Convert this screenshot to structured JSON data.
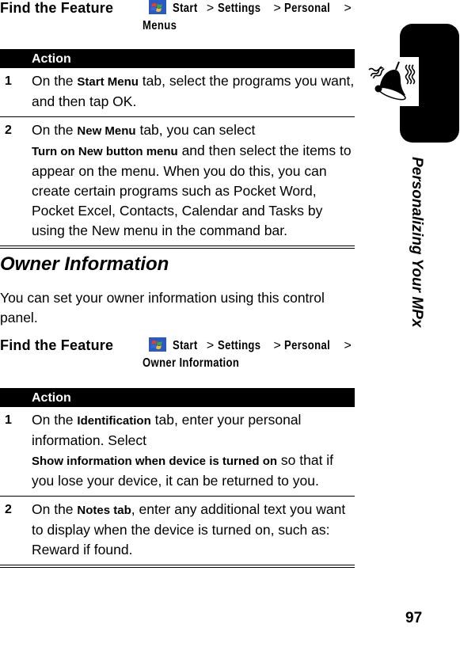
{
  "ftf1": {
    "label": "Find the Feature",
    "path": [
      "Start",
      "Settings",
      "Personal",
      "Menus"
    ],
    "separator": ">"
  },
  "table1": {
    "header": "Action",
    "rows": [
      {
        "num": "1",
        "parts": [
          {
            "t": "On the ",
            "b": false
          },
          {
            "t": "Start Menu",
            "b": true
          },
          {
            "t": " tab, select the programs you want, and then tap OK.",
            "b": false
          }
        ]
      },
      {
        "num": "2",
        "parts": [
          {
            "t": "On the ",
            "b": false
          },
          {
            "t": "New Menu",
            "b": true
          },
          {
            "t": " tab, you can select ",
            "b": false
          },
          {
            "t": "Turn on New button menu",
            "b": true
          },
          {
            "t": " and then select the items to appear on the menu. When you do this, you can create certain programs such as Pocket Word, Pocket Excel, Contacts, Calendar and Tasks by using the New menu in the command bar.",
            "b": false
          }
        ]
      }
    ]
  },
  "section": {
    "title": "Owner Information",
    "intro": "You can set your owner information using this control panel."
  },
  "ftf2": {
    "label": "Find the Feature",
    "path": [
      "Start",
      "Settings",
      "Personal",
      "Owner Information"
    ],
    "separator": ">"
  },
  "table2": {
    "header": "Action",
    "rows": [
      {
        "num": "1",
        "parts": [
          {
            "t": "On the ",
            "b": false
          },
          {
            "t": "Identification",
            "b": true
          },
          {
            "t": " tab, enter your personal information. Select ",
            "b": false
          },
          {
            "t": "Show information when device is turned on",
            "b": true
          },
          {
            "t": " so that if you lose your device, it can be returned to you.",
            "b": false
          }
        ]
      },
      {
        "num": "2",
        "parts": [
          {
            "t": "On the ",
            "b": false
          },
          {
            "t": "Notes tab",
            "b": true
          },
          {
            "t": ", enter any additional text you want to display when the device is turned on, such as: Reward if found.",
            "b": false
          }
        ]
      }
    ]
  },
  "sidebar": {
    "chapter_title": "Personalizing Your MPx",
    "icon": "ringing-bell-icon"
  },
  "footer": {
    "page_number": "97"
  },
  "colors": {
    "windows_flag": [
      "#e8401c",
      "#3aa83a",
      "#2a6fdc",
      "#f5c21b"
    ],
    "windows_bg": "#2b59c3"
  }
}
